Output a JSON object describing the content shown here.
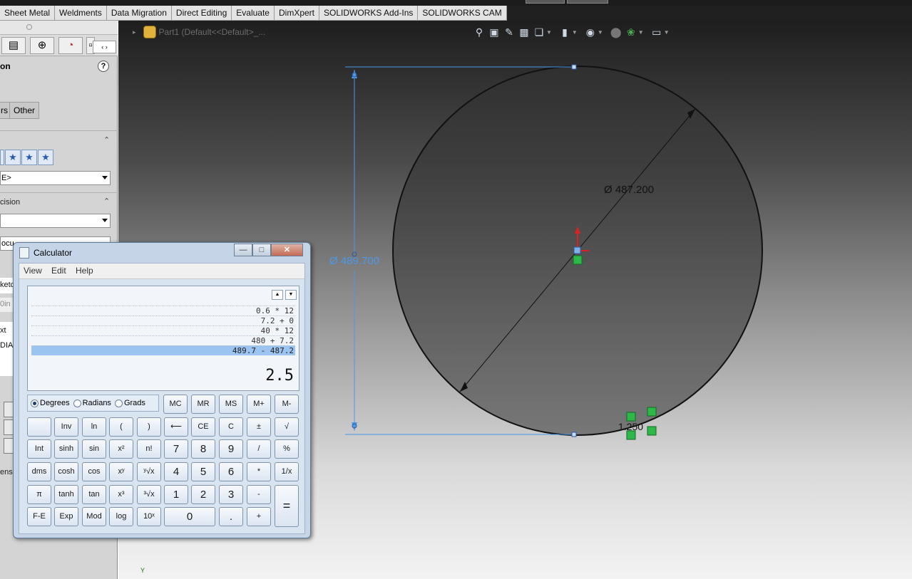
{
  "ribbon": {
    "tabs": [
      "Sheet Metal",
      "Weldments",
      "Data Migration",
      "Direct Editing",
      "Evaluate",
      "DimXpert",
      "SOLIDWORKS Add-Ins",
      "SOLIDWORKS CAM"
    ]
  },
  "property_manager": {
    "title_fragment": "on",
    "help_label": "?",
    "tab_arrows": "‹ ›",
    "subtabs": [
      "rs",
      "Other"
    ],
    "combo1_value": "E>",
    "section_precision": "cision",
    "combo2_value": "",
    "combo3_value": "ocu",
    "frag_sketch": "ketc",
    "frag_in": "0in",
    "frag_text": "xt",
    "frag_diam": "DIAM",
    "frag_dimension": "ensi"
  },
  "viewport": {
    "tree_item_label": "Part1 (Default<<Default>_...",
    "toolbar_icons": [
      "zoom-to-fit-icon",
      "zoom-to-area-icon",
      "previous-view-icon",
      "section-view-icon",
      "view-orientation-icon",
      "display-style-icon",
      "hide-show-items-icon",
      "edit-appearance-icon",
      "apply-scene-icon",
      "view-settings-icon"
    ],
    "dims": {
      "diameter_circle": "Ø 487.200",
      "diameter_linear": "Ø 489.700",
      "small_dim": "1.250"
    },
    "origin_label": "Y"
  },
  "calculator": {
    "title": "Calculator",
    "menu": [
      "View",
      "Edit",
      "Help"
    ],
    "history": [
      "0.6 * 12",
      "7.2 + 0",
      "40 * 12",
      "480 + 7.2",
      "489.7 - 487.2"
    ],
    "result": "2.5",
    "angle_modes": [
      "Degrees",
      "Radians",
      "Grads"
    ],
    "selected_mode": "Degrees",
    "memory_keys": [
      "MC",
      "MR",
      "MS",
      "M+",
      "M-"
    ],
    "rows": [
      [
        "",
        "Inv",
        "ln",
        "(",
        ")",
        "⟵",
        "CE",
        "C",
        "±",
        "√"
      ],
      [
        "Int",
        "sinh",
        "sin",
        "x²",
        "n!",
        "7",
        "8",
        "9",
        "/",
        "%"
      ],
      [
        "dms",
        "cosh",
        "cos",
        "xʸ",
        "ʸ√x",
        "4",
        "5",
        "6",
        "*",
        "1/x"
      ],
      [
        "π",
        "tanh",
        "tan",
        "x³",
        "³√x",
        "1",
        "2",
        "3",
        "-",
        "="
      ],
      [
        "F-E",
        "Exp",
        "Mod",
        "log",
        "10ˣ",
        "0",
        ".",
        "+"
      ]
    ],
    "win_buttons": {
      "minimize": "—",
      "maximize": "□",
      "close": "✕"
    }
  },
  "colors": {
    "dim_blue": "#4d98e8",
    "constraint_green": "#2fb84a",
    "axis_red": "#e02020"
  }
}
